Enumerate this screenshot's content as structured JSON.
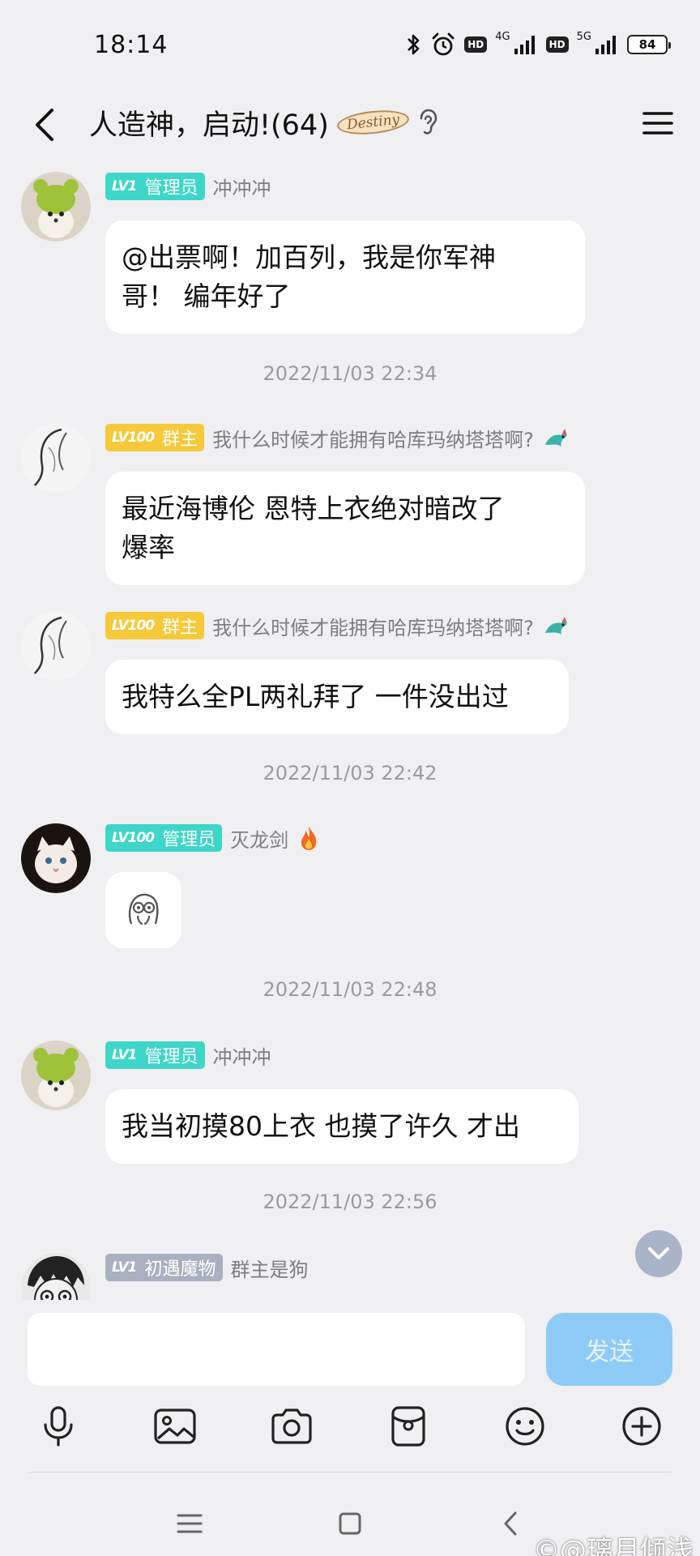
{
  "status_bar": {
    "time": "18:14",
    "network_1": "4G",
    "network_2": "5G",
    "hd_label": "HD",
    "battery": "84"
  },
  "header": {
    "title": "人造神，启动!(64)",
    "badge_text": "Destiny",
    "icons": [
      "back-arrow-icon",
      "ear-icon",
      "menu-icon"
    ]
  },
  "messages": [
    {
      "level": "LV1",
      "role": "管理员",
      "nickname": "冲冲冲",
      "text_lines": [
        "@出票啊！加百列，我是你军神",
        "哥！ 编年好了"
      ],
      "avatar": "green-hat-dog-avatar"
    },
    {
      "level": "LV100",
      "role": "群主",
      "nickname": "我什么时候才能拥有哈库玛纳塔塔啊?",
      "text_lines": [
        "最近海博伦 恩特上衣绝对暗改了",
        "爆率"
      ],
      "avatar": "sketch-girl-avatar"
    },
    {
      "level": "LV100",
      "role": "群主",
      "nickname": "我什么时候才能拥有哈库玛纳塔塔啊?",
      "text_lines": [
        "我特么全PL两礼拜了 一件没出过"
      ],
      "avatar": "sketch-girl-avatar"
    },
    {
      "level": "LV100",
      "role": "管理员",
      "nickname": "灭龙剑",
      "sticker": "scared-face-sticker",
      "avatar": "white-cat-avatar"
    },
    {
      "level": "LV1",
      "role": "管理员",
      "nickname": "冲冲冲",
      "text_lines": [
        "我当初摸80上衣 也摸了许久 才出"
      ],
      "avatar": "green-hat-dog-avatar"
    },
    {
      "level": "LV1",
      "role": "初遇魔物",
      "nickname": "群主是狗",
      "avatar": "manga-face-avatar"
    }
  ],
  "timestamps": [
    "2022/11/03 22:34",
    "2022/11/03 22:42",
    "2022/11/03 22:48",
    "2022/11/03 22:56"
  ],
  "input": {
    "placeholder": "",
    "send_label": "发送"
  },
  "toolbar": [
    "microphone-icon",
    "image-icon",
    "camera-icon",
    "red-packet-icon",
    "emoji-icon",
    "plus-icon"
  ],
  "watermark": "©@璃月倾浅",
  "colors": {
    "background": "#f0f0f2",
    "badge_teal": "#3ed6c8",
    "badge_gold": "#f6c93a",
    "badge_gray": "#a9b0bf",
    "send_button": "#8fcbf7"
  }
}
